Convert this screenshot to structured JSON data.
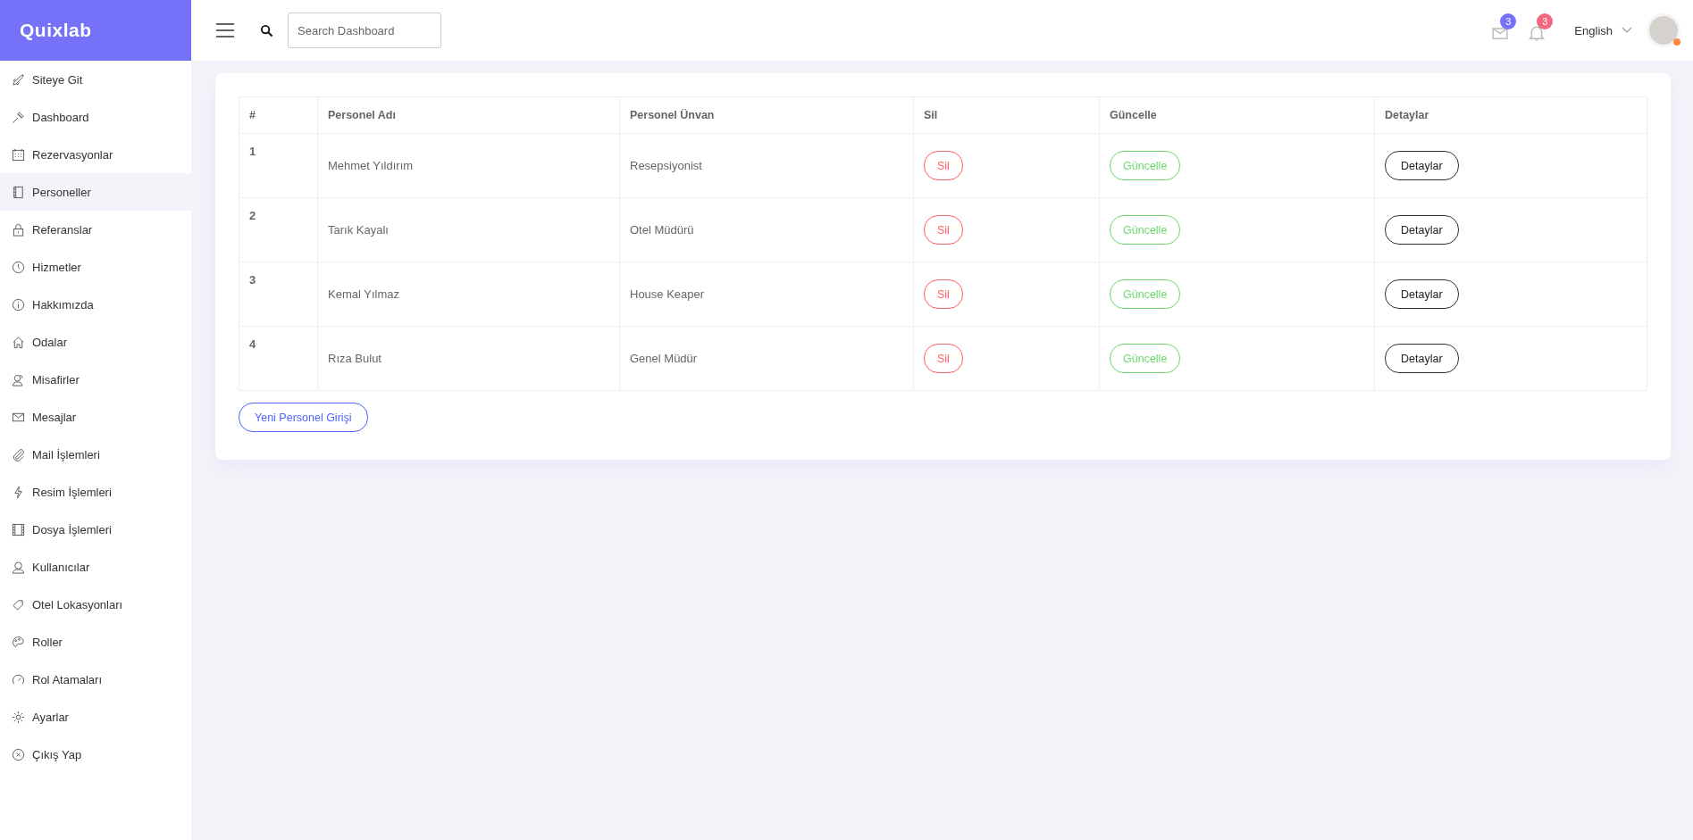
{
  "brand": "Quixlab",
  "sidebar": {
    "items": [
      {
        "label": "Siteye Git",
        "selected": false
      },
      {
        "label": "Dashboard",
        "selected": false
      },
      {
        "label": "Rezervasyonlar",
        "selected": false
      },
      {
        "label": "Personeller",
        "selected": true
      },
      {
        "label": "Referanslar",
        "selected": false
      },
      {
        "label": "Hizmetler",
        "selected": false
      },
      {
        "label": "Hakkımızda",
        "selected": false
      },
      {
        "label": "Odalar",
        "selected": false
      },
      {
        "label": "Misafirler",
        "selected": false
      },
      {
        "label": "Mesajlar",
        "selected": false
      },
      {
        "label": "Mail İşlemleri",
        "selected": false
      },
      {
        "label": "Resim İşlemleri",
        "selected": false
      },
      {
        "label": "Dosya İşlemleri",
        "selected": false
      },
      {
        "label": "Kullanıcılar",
        "selected": false
      },
      {
        "label": "Otel Lokasyonları",
        "selected": false
      },
      {
        "label": "Roller",
        "selected": false
      },
      {
        "label": "Rol Atamaları",
        "selected": false
      },
      {
        "label": "Ayarlar",
        "selected": false
      },
      {
        "label": "Çıkış Yap",
        "selected": false
      }
    ]
  },
  "header": {
    "search": {
      "placeholder": "Search Dashboard"
    },
    "notifications": [
      {
        "kind": "mail",
        "count": "3",
        "color": "#7571f9"
      },
      {
        "kind": "bell",
        "count": "3",
        "color": "#f3677f"
      }
    ],
    "language": "English"
  },
  "table": {
    "columns": [
      "#",
      "Personel Adı",
      "Personel Ünvan",
      "Sil",
      "Güncelle",
      "Detaylar"
    ],
    "rows": [
      {
        "number": "1",
        "name": "Mehmet Yıldırım",
        "title": "Resepsiyonist",
        "delete": "Sil",
        "update": "Güncelle",
        "details": "Detaylar"
      },
      {
        "number": "2",
        "name": "Tarık Kayalı",
        "title": "Otel Müdürü",
        "delete": "Sil",
        "update": "Güncelle",
        "details": "Detaylar"
      },
      {
        "number": "3",
        "name": "Kemal Yılmaz",
        "title": "House Keaper",
        "delete": "Sil",
        "update": "Güncelle",
        "details": "Detaylar"
      },
      {
        "number": "4",
        "name": "Rıza Bulut",
        "title": "Genel Müdür",
        "delete": "Sil",
        "update": "Güncelle",
        "details": "Detaylar"
      }
    ]
  },
  "add_button": "Yeni Personel Girişi"
}
